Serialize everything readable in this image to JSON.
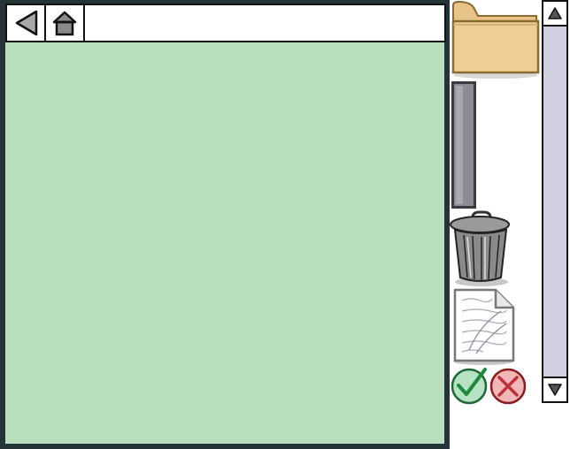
{
  "navigation": {
    "back_icon": "back-arrow-icon",
    "home_icon": "home-icon",
    "address_value": "",
    "address_placeholder": ""
  },
  "content": {
    "background_color": "#b9dfbc"
  },
  "tools": {
    "folder_icon": "folder-icon",
    "handle_icon": "slider-handle",
    "trash_icon": "trash-can-icon",
    "document_icon": "document-icon",
    "confirm_icon": "checkmark-icon",
    "cancel_icon": "x-mark-icon"
  },
  "scrollbar": {
    "up_icon": "up-arrow-icon",
    "down_icon": "down-arrow-icon"
  },
  "colors": {
    "frame": "#253436",
    "content": "#b9dfbc",
    "folder": "#f0cf94",
    "confirm": "#2e9a4a",
    "cancel": "#d44a4a",
    "scroll_track": "#d0cfe0"
  }
}
